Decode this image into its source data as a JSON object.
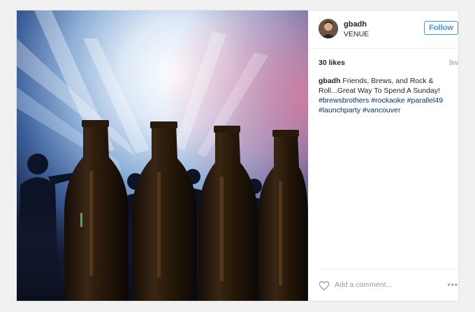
{
  "post": {
    "username": "gbadh",
    "location": "VENUE",
    "follow_label": "Follow",
    "likes": "30 likes",
    "time_ago": "9w",
    "caption_user": "gbadh",
    "caption_text": "Friends, Brews, and Rock & Roll...Great Way To Spend A Sunday!",
    "hashtags": [
      "#brewsbrothers",
      "#rockaoke",
      "#parallel49",
      "#launchparty",
      "#vancouver"
    ],
    "comment_placeholder": "Add a comment...",
    "more_icon": "•••"
  },
  "icons": {
    "heart": "heart-outline-icon",
    "more": "more-options-icon"
  },
  "colors": {
    "accent": "#3897f0",
    "hashtag": "#003569",
    "muted": "#999999"
  }
}
